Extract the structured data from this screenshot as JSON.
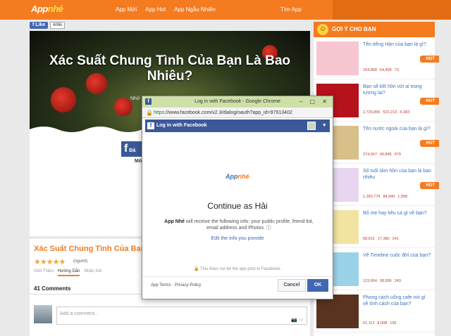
{
  "site": {
    "logo_prefix": "App",
    "logo_suffix": "nhé",
    "nav": [
      "App Mới",
      "App Hot",
      "App Ngẫu Nhiên"
    ],
    "search_label": "Tìm App"
  },
  "like": {
    "label": "Like",
    "count": "606k"
  },
  "hero": {
    "title": "Xác Suất Chung Tình Của Bạn Là Bao Nhiêu?",
    "subtitle_partial": "Nhữ"
  },
  "partial": {
    "fb_button": "Đă",
    "mo": "Mớ"
  },
  "card": {
    "title": "Xác Suất Chung Tình Của Bạn",
    "stars": "★★★★★",
    "votes": "(người)",
    "tabs": [
      "Giới Thiệu",
      "Hướng Dẫn",
      "Nhận Xét"
    ],
    "comments_count": "41 Comments",
    "comment_placeholder": "Add a comment..."
  },
  "sidebar": {
    "heading": "GỢI Ý CHO BẠN",
    "items": [
      {
        "title": "Tên tiếng Hàn của bạn là gì?",
        "views": "154,858",
        "likes": "54,409",
        "shares": "73",
        "hot": "HOT",
        "thumb_color": "#f7c6d0"
      },
      {
        "title": "Bạn sẽ kết hôn với ai trong tương lai?",
        "views": "2,726,855",
        "likes": "522,213",
        "shares": "4,383",
        "hot": "HOT",
        "thumb_color": "#b5121b"
      },
      {
        "title": "Tên nước ngoài của bạn là gì?",
        "views": "274,667",
        "likes": "40,845",
        "shares": "679",
        "hot": "HOT",
        "thumb_color": "#d8c08a"
      },
      {
        "title": "Số tuổi tâm hồn của bạn là bao nhiêu",
        "views": "1,350,779",
        "likes": "84,940",
        "shares": "1,058",
        "hot": "HOT",
        "thumb_color": "#e8d6f0"
      },
      {
        "title": "Bố mẹ hay kêu ca gì về bạn?",
        "views": "58,631",
        "likes": "17,380",
        "shares": "241",
        "hot": "",
        "thumb_color": "#f2e3a0"
      },
      {
        "title": "Vẽ Timeline cuộc đời của bạn?",
        "views": "123,654",
        "likes": "38,996",
        "shares": "243",
        "hot": "",
        "thumb_color": "#9ad3e8"
      },
      {
        "title": "Phong cách uống cafe nói gì về tính cách của bạn?",
        "views": "51,112",
        "likes": "8,008",
        "shares": "135",
        "hot": "",
        "thumb_color": "#5a3320"
      }
    ]
  },
  "popup": {
    "window_title": "Log in with Facebook - Google Chrome",
    "url_https": "https",
    "url_rest": "://www.facebook.com/v2.3/dialog/oauth?app_id=97913402",
    "fb_header": "Log in with Facebook",
    "app_logo_prefix": "App",
    "app_logo_suffix": "nhé",
    "continue_text": "Continue as Hải",
    "app_name": "App Nhé",
    "info_text": "will receive the following info: your public profile, friend list, email address and Photos.",
    "edit_link": "Edit the info you provide",
    "note": "This does not let the app post to Facebook.",
    "footer_links": "App Terms  ·  Privacy Policy",
    "cancel": "Cancel",
    "ok": "OK"
  },
  "colors": {
    "accent": "#f47b20",
    "facebook": "#3b5998",
    "link": "#3b73b9"
  }
}
